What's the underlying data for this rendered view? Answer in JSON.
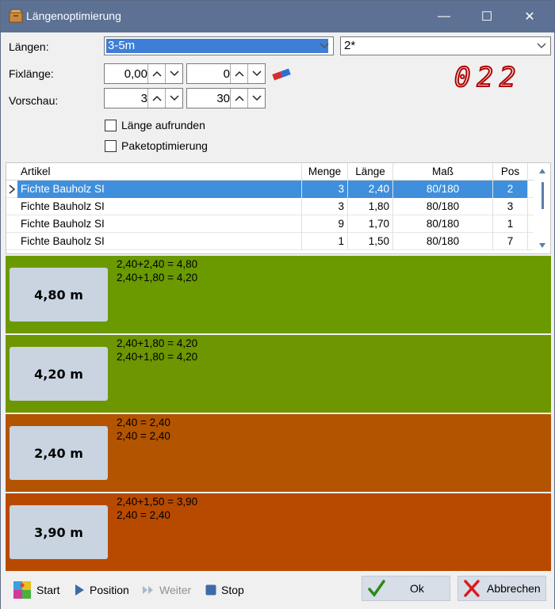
{
  "window": {
    "title": "Längenoptimierung",
    "controls": {
      "minimize": "—",
      "maximize": "☐",
      "close": "✕"
    }
  },
  "form": {
    "laengen_label": "Längen:",
    "laengen_value": "3-5m",
    "second_combo_value": "2*",
    "fixlaenge_label": "Fixlänge:",
    "fixlaenge_value1": "0,00",
    "fixlaenge_value2": "0",
    "vorschau_label": "Vorschau:",
    "vorschau_value1": "3",
    "vorschau_value2": "30",
    "check_aufrunden": "Länge aufrunden",
    "check_paket": "Paketoptimierung",
    "counter_display": "022"
  },
  "table": {
    "headers": {
      "artikel": "Artikel",
      "menge": "Menge",
      "laenge": "Länge",
      "mass": "Maß",
      "pos": "Pos"
    },
    "rows": [
      {
        "artikel": "Fichte Bauholz SI",
        "menge": "3",
        "laenge": "2,40",
        "mass": "80/180",
        "pos": "2"
      },
      {
        "artikel": "Fichte Bauholz SI",
        "menge": "3",
        "laenge": "1,80",
        "mass": "80/180",
        "pos": "3"
      },
      {
        "artikel": "Fichte Bauholz SI",
        "menge": "9",
        "laenge": "1,70",
        "mass": "80/180",
        "pos": "1"
      },
      {
        "artikel": "Fichte Bauholz SI",
        "menge": "1",
        "laenge": "1,50",
        "mass": "80/180",
        "pos": "7"
      }
    ]
  },
  "bands": [
    {
      "button": "4,80 m",
      "line1": "2,40+2,40 = 4,80",
      "line2": "2,40+1,80 = 4,20",
      "color": "#6a9a00"
    },
    {
      "button": "4,20 m",
      "line1": "2,40+1,80 = 4,20",
      "line2": "2,40+1,80 = 4,20",
      "color": "#6e9600"
    },
    {
      "button": "2,40 m",
      "line1": "2,40 = 2,40",
      "line2": "2,40 = 2,40",
      "color": "#b35400"
    },
    {
      "button": "3,90 m",
      "line1": "2,40+1,50 = 3,90",
      "line2": "2,40 = 2,40",
      "color": "#b84a00"
    }
  ],
  "toolbar": {
    "start": "Start",
    "position": "Position",
    "weiter": "Weiter",
    "stop": "Stop",
    "ok": "Ok",
    "abbrechen": "Abbrechen"
  },
  "colors": {
    "titlebar": "#5c7194",
    "selection": "#3f8fdc",
    "digits": "#b00000"
  }
}
